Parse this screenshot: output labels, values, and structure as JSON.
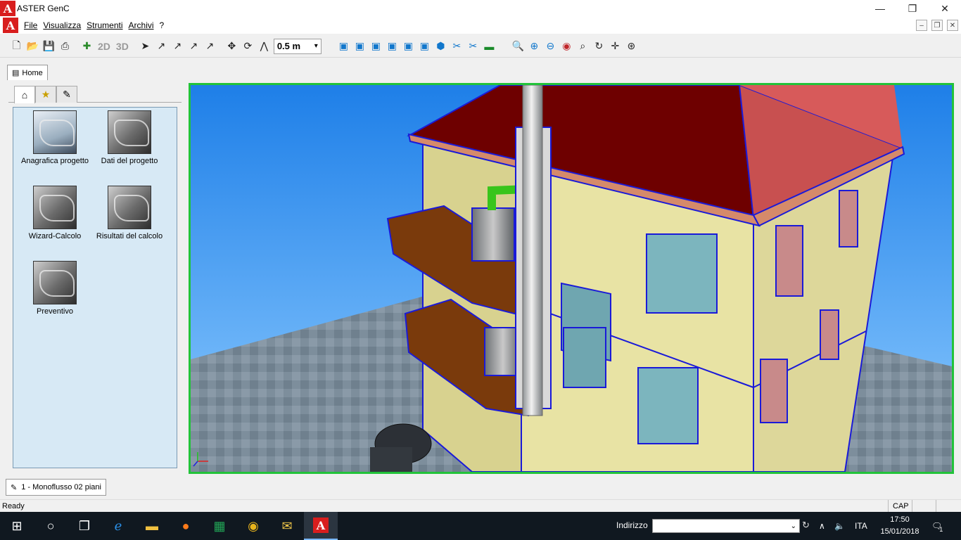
{
  "window": {
    "title": "ASTER GenC",
    "logo_letter": "A"
  },
  "menu": {
    "items": [
      "File",
      "Visualizza",
      "Strumenti",
      "Archivi",
      "?"
    ]
  },
  "toolbar": {
    "label_2d": "2D",
    "label_3d": "3D",
    "scale_value": "0.5  m"
  },
  "doc_tabs": {
    "home": "Home"
  },
  "panel": {
    "tab_icons": [
      "home-icon",
      "star-icon",
      "notepad-icon"
    ],
    "items": [
      "Anagrafica progetto",
      "Dati del progetto",
      "Wizard-Calcolo",
      "Risultati del calcolo",
      "Preventivo"
    ]
  },
  "bottom_tabs": {
    "project": "1 - Monoflusso 02 piani"
  },
  "status": {
    "text": "Ready",
    "cap": "CAP"
  },
  "taskbar": {
    "address_label": "Indirizzo",
    "language": "ITA",
    "time": "17:50",
    "date": "15/01/2018",
    "notification_count": "1"
  },
  "colors": {
    "viewport_border": "#22c33a",
    "sky": "#3aa0ff",
    "roof": "#7a0000",
    "wall": "#e8e3a4",
    "outline": "#1a1ad8"
  }
}
